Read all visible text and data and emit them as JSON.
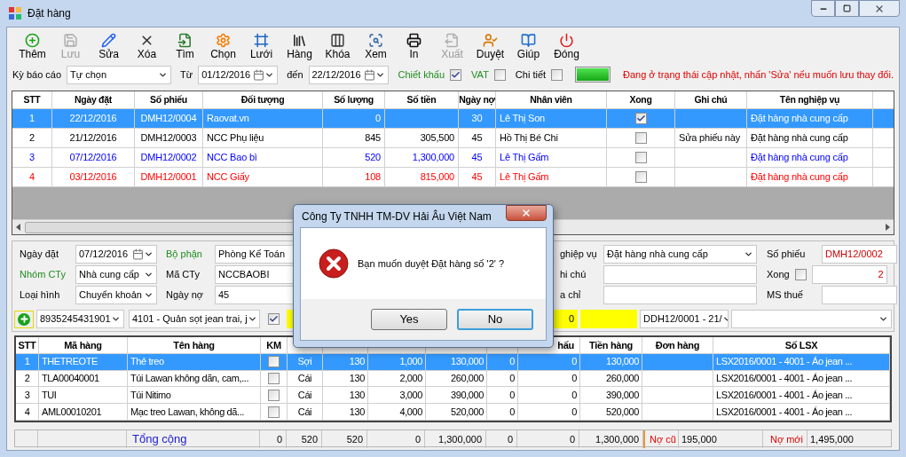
{
  "window": {
    "title": "Đặt hàng"
  },
  "toolbar": [
    {
      "label": "Thêm",
      "disabled": false
    },
    {
      "label": "Lưu",
      "disabled": true
    },
    {
      "label": "Sửa",
      "disabled": false
    },
    {
      "label": "Xóa",
      "disabled": false
    },
    {
      "label": "Tìm",
      "disabled": false
    },
    {
      "label": "Chọn",
      "disabled": false
    },
    {
      "label": "Lưới",
      "disabled": false
    },
    {
      "label": "Hàng",
      "disabled": false
    },
    {
      "label": "Khóa",
      "disabled": false
    },
    {
      "label": "Xem",
      "disabled": false
    },
    {
      "label": "In",
      "disabled": false
    },
    {
      "label": "Xuất",
      "disabled": true
    },
    {
      "label": "Duyệt",
      "disabled": false
    },
    {
      "label": "Giúp",
      "disabled": false
    },
    {
      "label": "Đóng",
      "disabled": false
    }
  ],
  "filter": {
    "period_label": "Kỳ báo cáo",
    "period": "Tự chọn",
    "from_label": "Từ",
    "from": "01/12/2016",
    "to_label": "đến",
    "to": "22/12/2016",
    "options": [
      {
        "label": "Chiết khấu",
        "color": "#1e8c1e",
        "checked": true
      },
      {
        "label": "VAT",
        "color": "#1e8c1e",
        "checked": false
      },
      {
        "label": "Chi tiết",
        "checked": false
      }
    ],
    "progress": {
      "level": 1
    },
    "status": "Đang ở trạng thái cập nhật, nhấn 'Sửa' nếu muốn lưu thay đổi."
  },
  "orders": {
    "columns": [
      "STT",
      "Ngày đặt",
      "Số phiếu",
      "Đối tượng",
      "Số lượng",
      "Số tiền",
      "Ngày nợ",
      "Nhân viên",
      "Xong",
      "Ghi chú",
      "Tên nghiệp vụ"
    ],
    "rows": [
      {
        "selected": true,
        "stt": "1",
        "date": "22/12/2016",
        "voucher": "DMH12/0004",
        "party": "Raovat.vn",
        "qty": "0",
        "due_days": "30",
        "staff": "Lê Thị Son",
        "done": true,
        "business": "Đặt hàng nhà cung cấp"
      },
      {
        "selected": false,
        "color": "#000000",
        "stt": "2",
        "date": "21/12/2016",
        "voucher": "DMH12/0003",
        "party": "NCC Phụ liệu",
        "qty": "845",
        "amount": "305,500",
        "due_days": "45",
        "staff": "Hồ Thị Bé Chi",
        "done": false,
        "note": "Sửa phiếu này",
        "business": "Đặt hàng nhà cung cấp"
      },
      {
        "selected": false,
        "color": "#0000ff",
        "stt": "3",
        "date": "07/12/2016",
        "voucher": "DMH12/0002",
        "party": "NCC Bao bì",
        "qty": "520",
        "amount": "1,300,000",
        "due_days": "45",
        "staff": "Lê Thị Gấm",
        "done": false,
        "business": "Đặt hàng nhà cung cấp"
      },
      {
        "selected": false,
        "color": "#ff0000",
        "stt": "4",
        "date": "03/12/2016",
        "voucher": "DMH12/0001",
        "party": "NCC Giấy",
        "qty": "108",
        "amount": "815,000",
        "due_days": "45",
        "staff": "Lê Thị Gấm",
        "done": false,
        "business": "Đặt hàng nhà cung cấp"
      }
    ]
  },
  "form": {
    "order_date_label": "Ngày đặt",
    "order_date": "07/12/2016",
    "department_label": {
      "text": "Bộ phận",
      "color": "#1e8c1e"
    },
    "department": "Phòng Kế Toán",
    "business_label": "ghiệp vụ",
    "business": "Đặt hàng nhà cung cấp",
    "voucher_label": "Số phiếu",
    "voucher": "DMH12/0002",
    "group_label": {
      "text": "Nhóm CTy",
      "color": "#1e8c1e"
    },
    "group": "Nhà cung cấp",
    "company_code_label": "Mã CTy",
    "company_code": "NCCBAOBI",
    "note_label": "hi chú",
    "done_label": "Xong",
    "done": false,
    "number": "2",
    "type_label": "Loại hình",
    "type": "Chuyển khoản",
    "due_label": "Ngày nợ",
    "due": "45",
    "address_label": "a chỉ",
    "tax_label": "MS thuế"
  },
  "entry": {
    "barcode": "8935245431901",
    "product": "4101 - Quản sọt jean trai, j",
    "promo": true,
    "value": "0",
    "order": "DDH12/0001 - 21/"
  },
  "items": {
    "columns": [
      "STT",
      "Mã hàng",
      "Tên hàng",
      "KM",
      "hấu",
      "Tiền hàng",
      "Đơn hàng",
      "Số LSX"
    ],
    "rows": [
      {
        "selected": true,
        "stt": "1",
        "code": "THETREOTE",
        "name": "Thẻ treo",
        "promo": false,
        "values": [
          "Sợi",
          "130",
          "1,000",
          "130,000",
          "0",
          "0",
          "130,000"
        ],
        "lsx": "LSX2016/0001 - 4001 - Áo jean ..."
      },
      {
        "selected": false,
        "stt": "2",
        "code": "TLA00040001",
        "name": "Túi Lawan không dãn, cam,...",
        "promo": false,
        "values": [
          "Cái",
          "130",
          "2,000",
          "260,000",
          "0",
          "0",
          "260,000"
        ],
        "lsx": "LSX2016/0001 - 4001 - Áo jean ..."
      },
      {
        "selected": false,
        "stt": "3",
        "code": "TUI",
        "name": "Túi Nitimo",
        "promo": false,
        "values": [
          "Cái",
          "130",
          "3,000",
          "390,000",
          "0",
          "0",
          "390,000"
        ],
        "lsx": "LSX2016/0001 - 4001 - Áo jean ..."
      },
      {
        "selected": false,
        "stt": "4",
        "code": "AML00010201",
        "name": "Mạc treo Lawan, không dã...",
        "promo": false,
        "values": [
          "Cái",
          "130",
          "4,000",
          "520,000",
          "0",
          "0",
          "520,000"
        ],
        "lsx": "LSX2016/0001 - 4001 - Áo jean ..."
      }
    ],
    "totals": {
      "label": "Tổng cộng",
      "values": [
        "0",
        "520",
        "520",
        "0",
        "1,300,000",
        "0",
        "0",
        "1,300,000"
      ],
      "old_debt_label": "Nợ cũ",
      "old_debt": "195,000",
      "new_debt_label": "Nợ mới",
      "new_debt": "1,495,000"
    }
  },
  "dialog": {
    "title": "Công Ty TNHH TM-DV Hải Âu Việt Nam",
    "message": "Bạn muốn duyệt Đặt hàng số '2' ?",
    "buttons": [
      {
        "label": "Yes",
        "selected": false
      },
      {
        "label": "No",
        "selected": true
      }
    ]
  }
}
